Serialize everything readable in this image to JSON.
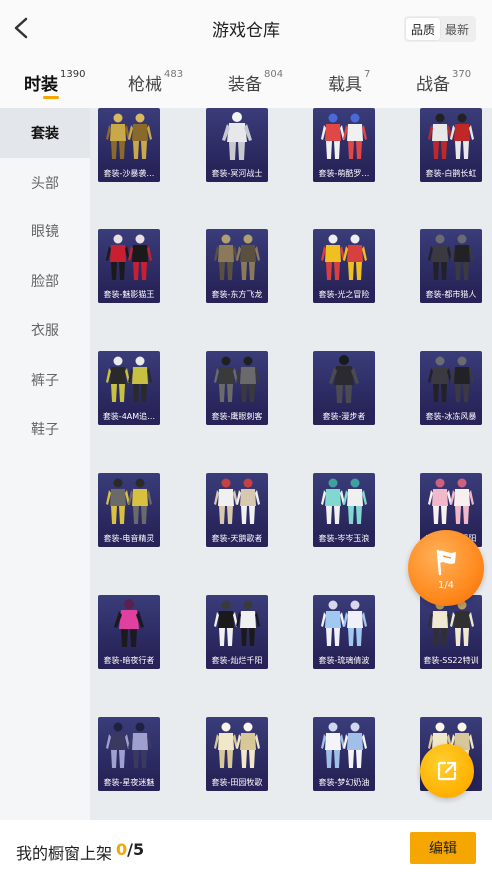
{
  "header": {
    "title": "游戏仓库",
    "sort_options": [
      "品质",
      "最新"
    ],
    "sort_selected": "品质"
  },
  "tabs": [
    {
      "label": "时装",
      "count": "1390",
      "active": true
    },
    {
      "label": "枪械",
      "count": "483",
      "active": false
    },
    {
      "label": "装备",
      "count": "804",
      "active": false
    },
    {
      "label": "载具",
      "count": "7",
      "active": false
    },
    {
      "label": "战备",
      "count": "370",
      "active": false
    }
  ],
  "sidebar": {
    "items": [
      {
        "label": "套装",
        "active": true
      },
      {
        "label": "头部",
        "active": false
      },
      {
        "label": "眼镜",
        "active": false
      },
      {
        "label": "脸部",
        "active": false
      },
      {
        "label": "衣服",
        "active": false
      },
      {
        "label": "裤子",
        "active": false
      },
      {
        "label": "鞋子",
        "active": false
      }
    ]
  },
  "grid": {
    "items": [
      {
        "label": "套装-沙暴袭…",
        "fig": "gold-armor"
      },
      {
        "label": "套装-冥河战士",
        "fig": "white-figure"
      },
      {
        "label": "套装-萌酷罗…",
        "fig": "colorful-pair"
      },
      {
        "label": "套装-白鹊长虹",
        "fig": "red-white-pair"
      },
      {
        "label": "套装-魅影猫王",
        "fig": "red-black-pair"
      },
      {
        "label": "套装-东方飞龙",
        "fig": "tan-pair"
      },
      {
        "label": "套装-光之冒险",
        "fig": "yellow-pair"
      },
      {
        "label": "套装-都市猎人",
        "fig": "dark-pair"
      },
      {
        "label": "套装-4AM追…",
        "fig": "dark-yellow-pair"
      },
      {
        "label": "套装-鹰眼刺客",
        "fig": "dark-armor"
      },
      {
        "label": "套装-漫步者",
        "fig": "dark-cloak"
      },
      {
        "label": "套装-冰冻风暴",
        "fig": "dark-pair"
      },
      {
        "label": "套装-电音精灵",
        "fig": "grey-yellow-pair"
      },
      {
        "label": "套装-天鹅歌者",
        "fig": "white-pair"
      },
      {
        "label": "套装-岑岑玉浪",
        "fig": "teal-pair"
      },
      {
        "label": "套装-晨曦暖阳",
        "fig": "pink-pair"
      },
      {
        "label": "套装-暗夜行者",
        "fig": "pink-dark-figure"
      },
      {
        "label": "套装-灿烂千阳",
        "fig": "black-suit-pair"
      },
      {
        "label": "套装-琉璃倩波",
        "fig": "lightblue-pair"
      },
      {
        "label": "套装-SS22特训",
        "fig": "mixed-pair"
      },
      {
        "label": "套装-星夜迷魅",
        "fig": "dark-blue-pair"
      },
      {
        "label": "套装-田园牧歌",
        "fig": "cream-pair"
      },
      {
        "label": "套装-梦幻奶油",
        "fig": "white-blue-pair"
      },
      {
        "label": "套装-…银",
        "fig": "cream-pair"
      }
    ]
  },
  "float_flag": {
    "pages": "1/4",
    "icon": "flag-icon"
  },
  "float_share": {
    "icon": "share-icon"
  },
  "bottom": {
    "showcase_label": "我的橱窗上架",
    "current": "0",
    "total": "/5",
    "edit_label": "编辑"
  },
  "colors": {
    "accent": "#f5a600",
    "card_bg": "#2c2a62",
    "grid_bg": "#e9ecef",
    "sidebar_bg": "#f5f6f8",
    "float_orange": "#ff8a1f"
  }
}
